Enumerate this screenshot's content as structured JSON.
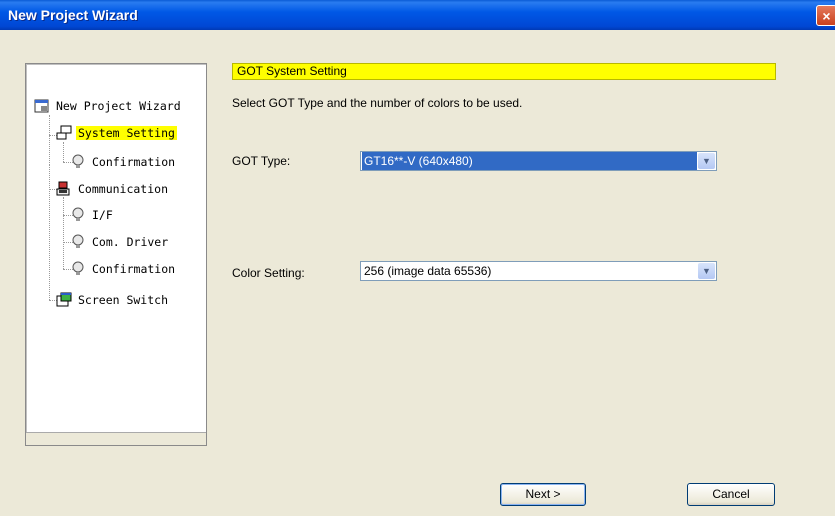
{
  "window": {
    "title": "New Project Wizard",
    "close_glyph": "×"
  },
  "tree": {
    "root": {
      "label": "New Project Wizard",
      "icon": "wizard-root-icon"
    },
    "items": [
      {
        "label": "System Setting",
        "icon": "system-setting-icon",
        "selected": true
      },
      {
        "label": "Confirmation",
        "icon": "lightbulb-icon"
      },
      {
        "label": "Communication",
        "icon": "communication-icon"
      },
      {
        "label": "I/F",
        "icon": "lightbulb-icon"
      },
      {
        "label": "Com. Driver",
        "icon": "lightbulb-icon"
      },
      {
        "label": "Confirmation",
        "icon": "lightbulb-icon"
      },
      {
        "label": "Screen Switch",
        "icon": "screen-switch-icon"
      }
    ]
  },
  "header": {
    "title": "GOT System Setting"
  },
  "description": "Select GOT Type and the number of colors to be used.",
  "got_type": {
    "label": "GOT Type:",
    "value": "GT16**-V (640x480)"
  },
  "color_setting": {
    "label": "Color Setting:",
    "value": "256 (image data 65536)"
  },
  "buttons": {
    "next": "Next >",
    "cancel": "Cancel"
  },
  "colors": {
    "title_bar": "#0054e3",
    "highlight": "#ffff00",
    "selection": "#316ac5",
    "face": "#ece9d8"
  }
}
